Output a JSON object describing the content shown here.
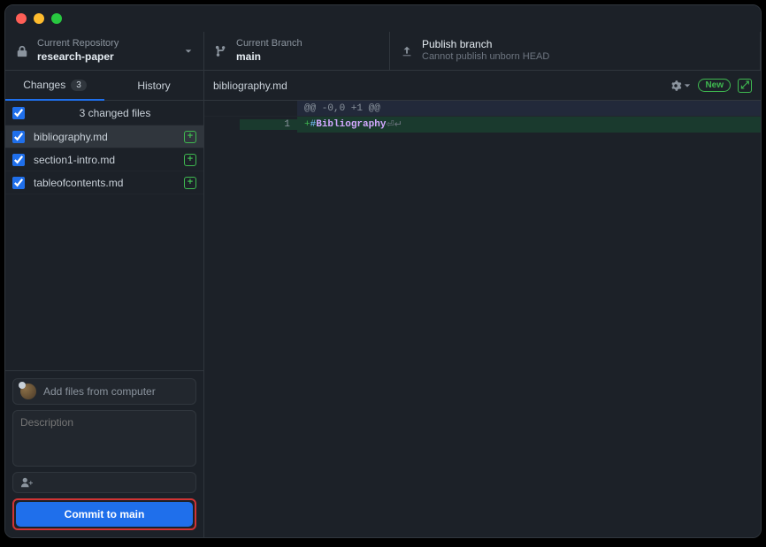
{
  "toolbar": {
    "repo_label": "Current Repository",
    "repo_name": "research-paper",
    "branch_label": "Current Branch",
    "branch_name": "main",
    "publish_label": "Publish branch",
    "publish_sub": "Cannot publish unborn HEAD"
  },
  "sidebar": {
    "tabs": {
      "changes": "Changes",
      "count": "3",
      "history": "History"
    },
    "changed_header": "3 changed files",
    "files": [
      {
        "name": "bibliography.md",
        "status": "+"
      },
      {
        "name": "section1-intro.md",
        "status": "+"
      },
      {
        "name": "tableofcontents.md",
        "status": "+"
      }
    ]
  },
  "commit": {
    "summary_placeholder": "Add files from computer",
    "description_placeholder": "Description",
    "button_prefix": "Commit to ",
    "button_branch": "main"
  },
  "content": {
    "filename": "bibliography.md",
    "new_label": "New",
    "hunk": "@@ -0,0 +1 @@",
    "line_no": "1",
    "diff_plus": "+",
    "diff_hash": "# ",
    "diff_text": "Bibliography",
    "diff_ws": "⏎↵"
  }
}
